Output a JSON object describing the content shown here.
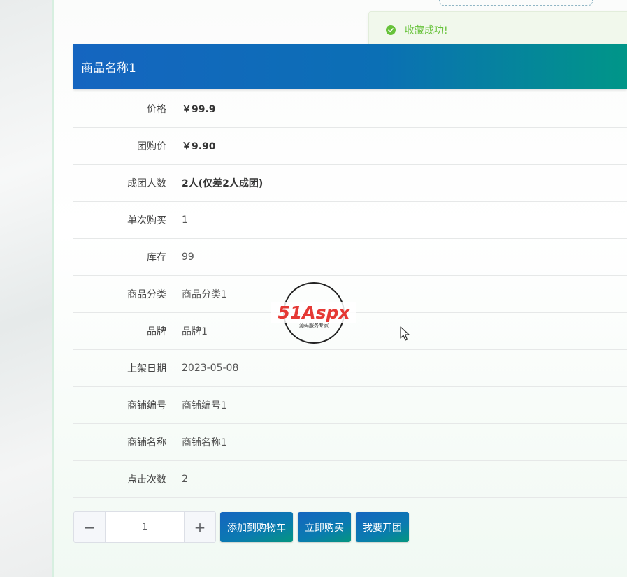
{
  "toast": {
    "icon": "check-circle-icon",
    "message": "收藏成功!"
  },
  "header": {
    "title": "商品名称1"
  },
  "details": [
    {
      "label": "价格",
      "value": "￥99.9",
      "bold": true
    },
    {
      "label": "团购价",
      "value": "￥9.90",
      "bold": true
    },
    {
      "label": "成团人数",
      "value": "2人(仅差2人成团)",
      "bold": true
    },
    {
      "label": "单次购买",
      "value": "1",
      "bold": false
    },
    {
      "label": "库存",
      "value": "99",
      "bold": false
    },
    {
      "label": "商品分类",
      "value": "商品分类1",
      "bold": false
    },
    {
      "label": "品牌",
      "value": "品牌1",
      "bold": false
    },
    {
      "label": "上架日期",
      "value": "2023-05-08",
      "bold": false
    },
    {
      "label": "商铺编号",
      "value": "商铺编号1",
      "bold": false
    },
    {
      "label": "商铺名称",
      "value": "商铺名称1",
      "bold": false
    },
    {
      "label": "点击次数",
      "value": "2",
      "bold": false
    }
  ],
  "controls": {
    "quantity": "1",
    "minus_label": "−",
    "plus_label": "+",
    "add_to_cart": "添加到购物车",
    "buy_now": "立即购买",
    "open_group": "我要开团"
  },
  "watermark": {
    "brand": "51Aspx",
    "tagline": "源码服务专家"
  },
  "colors": {
    "accent_blue": "#1565c0",
    "accent_teal": "#009688",
    "success": "#67c23a"
  }
}
